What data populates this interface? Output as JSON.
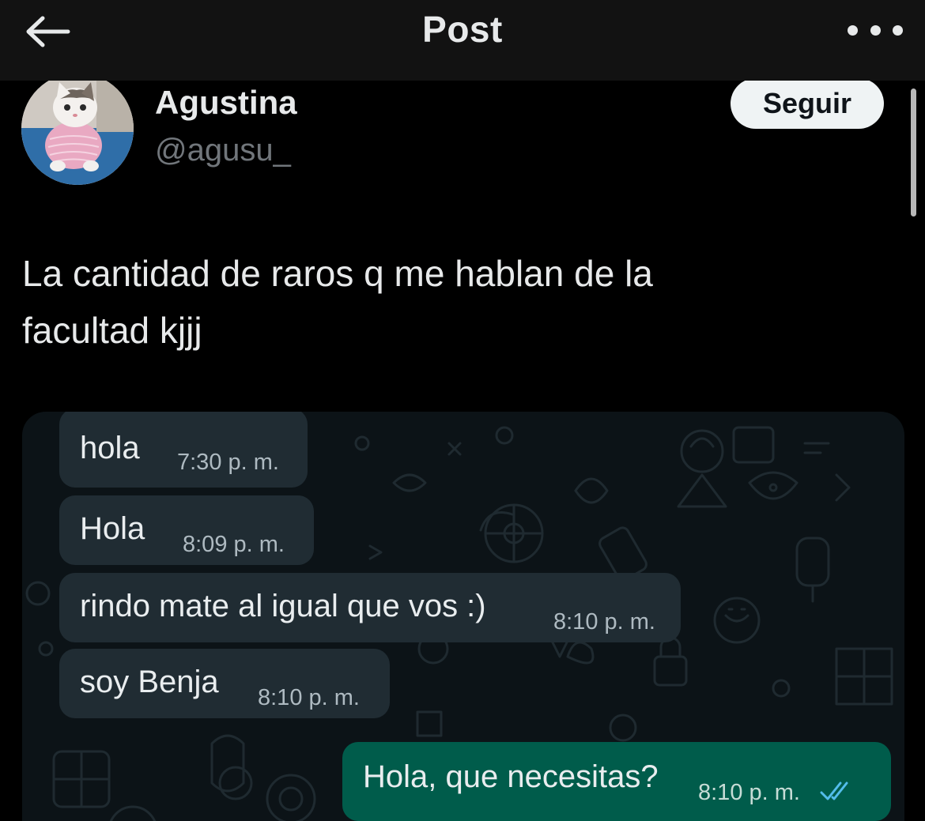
{
  "header": {
    "title": "Post",
    "back_icon": "arrow-left-icon",
    "more_icon": "more-horizontal-icon"
  },
  "author": {
    "name": "Agustina",
    "handle": "@agusu_",
    "follow_label": "Seguir"
  },
  "tweet": {
    "line1": "La cantidad de raros q me hablan de la",
    "line2": "facultad kjjj"
  },
  "chat": {
    "messages": [
      {
        "text": "hola",
        "time": "7:30 p. m.",
        "direction": "incoming"
      },
      {
        "text": "Hola",
        "time": "8:09 p. m.",
        "direction": "incoming"
      },
      {
        "text": "rindo mate al igual que vos :)",
        "time": "8:10 p. m.",
        "direction": "incoming"
      },
      {
        "text": "soy Benja",
        "time": "8:10 p. m.",
        "direction": "incoming"
      },
      {
        "text": "Hola, que necesitas?",
        "time": "8:10 p. m.",
        "direction": "outgoing",
        "status_icon": "double-check-read-icon"
      }
    ]
  },
  "colors": {
    "background": "#000000",
    "topbar": "#121212",
    "incoming_bubble": "#202c33",
    "outgoing_bubble": "#005c4b",
    "read_ticks": "#53bdeb",
    "follow_button": "#eff3f4"
  }
}
